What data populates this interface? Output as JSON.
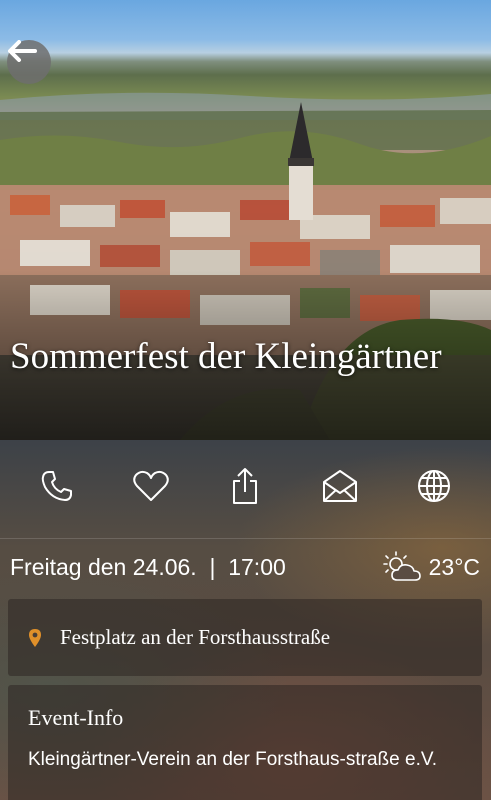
{
  "event": {
    "title": "Sommerfest der Kleingärtner",
    "date": "Freitag den 24.06.  |  17:00",
    "temperature": "23°C",
    "weather_icon": "partly-cloudy-icon",
    "location": "Festplatz an der Forsthausstraße"
  },
  "actions": [
    {
      "icon": "phone-icon"
    },
    {
      "icon": "heart-icon"
    },
    {
      "icon": "share-icon"
    },
    {
      "icon": "mail-icon"
    },
    {
      "icon": "globe-icon"
    }
  ],
  "info": {
    "heading": "Event-Info",
    "body": "Kleingärtner-Verein an der Forsthaus-straße e.V."
  },
  "colors": {
    "location_pin": "#e0902a",
    "text": "#ffffff"
  }
}
